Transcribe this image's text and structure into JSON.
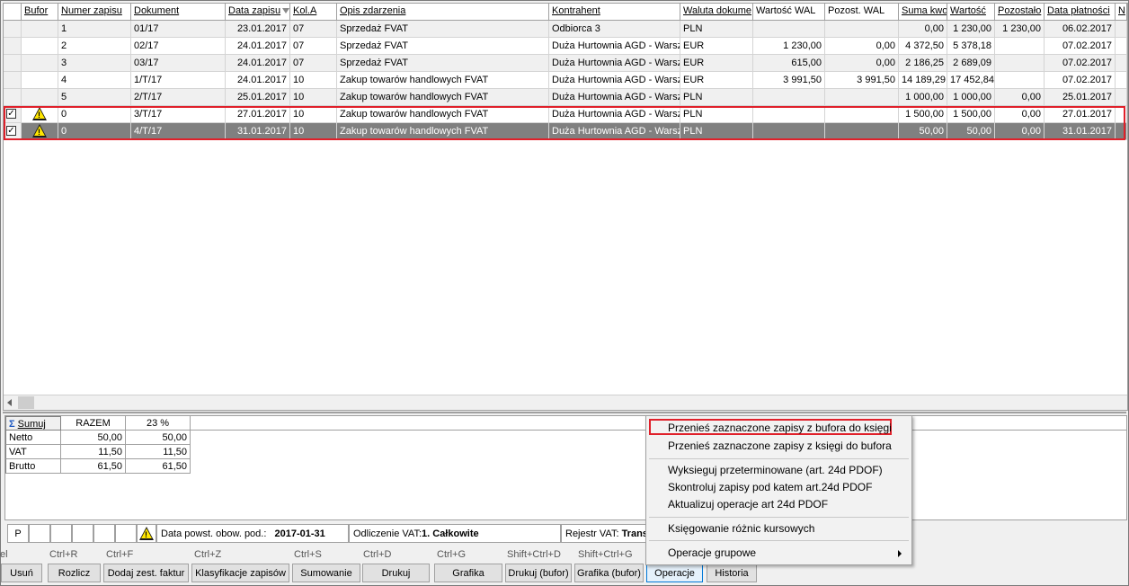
{
  "grid": {
    "headers": [
      "Bufor",
      "Numer zapisu",
      "Dokument",
      "Data zapisu",
      "Kol.A",
      "Opis zdarzenia",
      "Kontrahent",
      "Waluta dokume",
      "Wartość WAL",
      "Pozost. WAL",
      "Suma kwo",
      "Wartość",
      "Pozostało",
      "Data płatności",
      "N"
    ],
    "rows": [
      {
        "num": "1",
        "doc": "01/17",
        "date": "23.01.2017",
        "kol": "07",
        "opis": "Sprzedaż FVAT",
        "kontr": "Odbiorca 3",
        "wal": "PLN",
        "wwal": "",
        "pwal": "",
        "suma": "0,00",
        "wart": "1 230,00",
        "poz": "1 230,00",
        "dpl": "06.02.2017"
      },
      {
        "num": "2",
        "doc": "02/17",
        "date": "24.01.2017",
        "kol": "07",
        "opis": "Sprzedaż FVAT",
        "kontr": "Duża Hurtownia AGD - Warszawa",
        "wal": "EUR",
        "wwal": "1 230,00",
        "pwal": "0,00",
        "suma": "4 372,50",
        "wart": "5 378,18",
        "poz": "",
        "dpl": "07.02.2017"
      },
      {
        "num": "3",
        "doc": "03/17",
        "date": "24.01.2017",
        "kol": "07",
        "opis": "Sprzedaż FVAT",
        "kontr": "Duża Hurtownia AGD - Warszawa",
        "wal": "EUR",
        "wwal": "615,00",
        "pwal": "0,00",
        "suma": "2 186,25",
        "wart": "2 689,09",
        "poz": "",
        "dpl": "07.02.2017"
      },
      {
        "num": "4",
        "doc": "1/T/17",
        "date": "24.01.2017",
        "kol": "10",
        "opis": "Zakup towarów handlowych FVAT",
        "kontr": "Duża Hurtownia AGD - Warszawa",
        "wal": "EUR",
        "wwal": "3 991,50",
        "pwal": "3 991,50",
        "suma": "14 189,29",
        "wart": "17 452,84",
        "poz": "",
        "dpl": "07.02.2017"
      },
      {
        "num": "5",
        "doc": "2/T/17",
        "date": "25.01.2017",
        "kol": "10",
        "opis": "Zakup towarów handlowych FVAT",
        "kontr": "Duża Hurtownia AGD - Warszawa",
        "wal": "PLN",
        "wwal": "",
        "pwal": "",
        "suma": "1 000,00",
        "wart": "1 000,00",
        "poz": "0,00",
        "dpl": "25.01.2017"
      },
      {
        "num": "0",
        "doc": "3/T/17",
        "date": "27.01.2017",
        "kol": "10",
        "opis": "Zakup towarów handlowych FVAT",
        "kontr": "Duża Hurtownia AGD - Warszawa",
        "wal": "PLN",
        "wwal": "",
        "pwal": "",
        "suma": "1 500,00",
        "wart": "1 500,00",
        "poz": "0,00",
        "dpl": "27.01.2017"
      },
      {
        "num": "0",
        "doc": "4/T/17",
        "date": "31.01.2017",
        "kol": "10",
        "opis": "Zakup towarów handlowych FVAT",
        "kontr": "Duża Hurtownia AGD - Warszawa",
        "wal": "PLN",
        "wwal": "",
        "pwal": "",
        "suma": "50,00",
        "wart": "50,00",
        "poz": "0,00",
        "dpl": "31.01.2017"
      }
    ]
  },
  "summary": {
    "sumuj": "Sumuj",
    "col_razem": "RAZEM",
    "col_23": "23 %",
    "rows": [
      {
        "label": "Netto",
        "razem": "50,00",
        "v23": "50,00"
      },
      {
        "label": "VAT",
        "razem": "11,50",
        "v23": "11,50"
      },
      {
        "label": "Brutto",
        "razem": "61,50",
        "v23": "61,50"
      }
    ]
  },
  "status": {
    "p": "P",
    "data_label": "Data powst. obow. pod.:",
    "data_value": "2017-01-31",
    "odl_label": "Odliczenie VAT:",
    "odl_value": "1. Całkowite",
    "rej_label": "Rejestr VAT:",
    "rej_value": "Trans"
  },
  "shortcuts": [
    "el",
    "Ctrl+R",
    "Ctrl+F",
    "Ctrl+Z",
    "Ctrl+S",
    "Ctrl+D",
    "Ctrl+G",
    "Shift+Ctrl+D",
    "Shift+Ctrl+G"
  ],
  "buttons": [
    "Usuń",
    "Rozlicz",
    "Dodaj zest. faktur",
    "Klasyfikacje zapisów",
    "Sumowanie",
    "Drukuj",
    "Grafika",
    "Drukuj (bufor)",
    "Grafika (bufor)",
    "Operacje",
    "Historia"
  ],
  "menu": {
    "items": [
      "Przenieś zaznaczone zapisy z bufora do księgi",
      "Przenieś zaznaczone zapisy z księgi do bufora",
      "Wyksieguj przeterminowane (art. 24d PDOF)",
      "Skontroluj zapisy pod katem art.24d PDOF",
      "Aktualizuj operacje art 24d PDOF",
      "Księgowanie różnic kursowych",
      "Operacje grupowe"
    ]
  }
}
